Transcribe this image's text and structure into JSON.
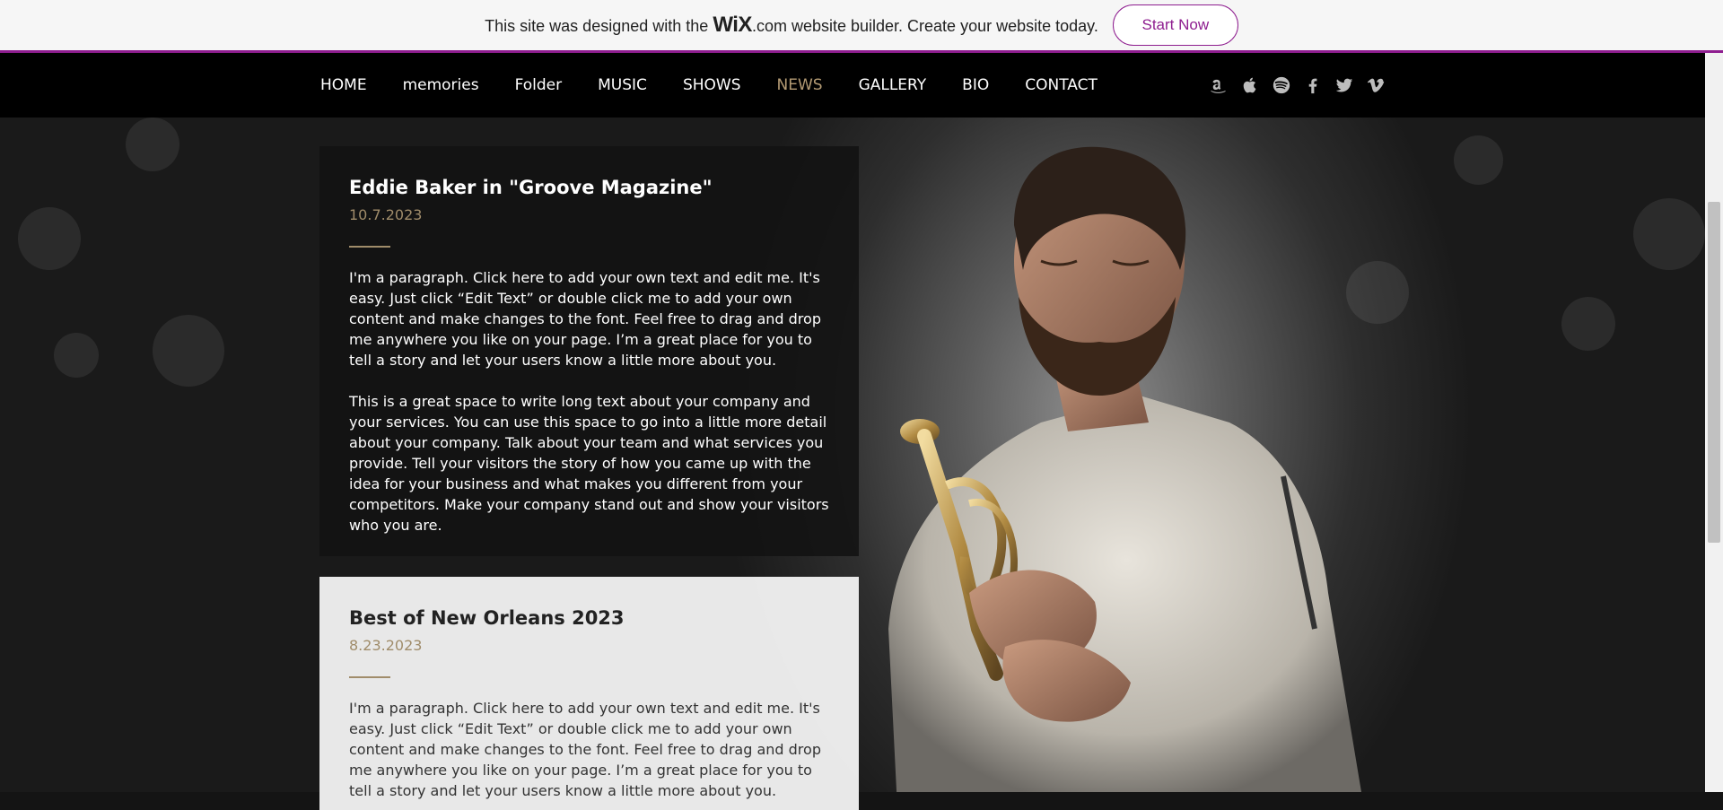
{
  "banner": {
    "text_before": "This site was designed with the",
    "logo": "WiX",
    "logo_suffix": ".com",
    "text_after": "website builder. Create your website today.",
    "button_label": "Start Now",
    "accent_color": "#8e1d8f"
  },
  "nav": {
    "items": [
      {
        "label": "HOME"
      },
      {
        "label": "memories"
      },
      {
        "label": "Folder"
      },
      {
        "label": "MUSIC"
      },
      {
        "label": "SHOWS"
      },
      {
        "label": "NEWS",
        "active": true
      },
      {
        "label": "GALLERY"
      },
      {
        "label": "BIO"
      },
      {
        "label": "CONTACT"
      }
    ],
    "active_color": "#b49b74",
    "social_icons": [
      "amazon-icon",
      "apple-icon",
      "spotify-icon",
      "facebook-icon",
      "twitter-icon",
      "vimeo-icon"
    ]
  },
  "articles": [
    {
      "title": "Eddie Baker in \"Groove Magazine\"",
      "date": "10.7.2023",
      "paragraphs": [
        "I'm a paragraph. Click here to add your own text and edit me. It's easy. Just click “Edit Text” or double click me to add your own content and make changes to the font. Feel free to drag and drop me anywhere you like on your page. I’m a great place for you to tell a story and let your users know a little more about you.",
        "This is a great space to write long text about your company and your services. You can use this space to go into a little more detail about your company. Talk about your team and what services you provide. Tell your visitors the story of how you came up with the idea for your business and what makes you different from your competitors. Make your company stand out and show your visitors who you are."
      ]
    },
    {
      "title": "Best of New Orleans 2023",
      "date": "8.23.2023",
      "paragraphs": [
        "I'm a paragraph. Click here to add your own text and edit me. It's easy. Just click “Edit Text” or double click me to add your own content and make changes to the font. Feel free to drag and drop me anywhere you like on your page. I’m a great place for you to tell a story and let your users know a little more about you."
      ]
    }
  ]
}
